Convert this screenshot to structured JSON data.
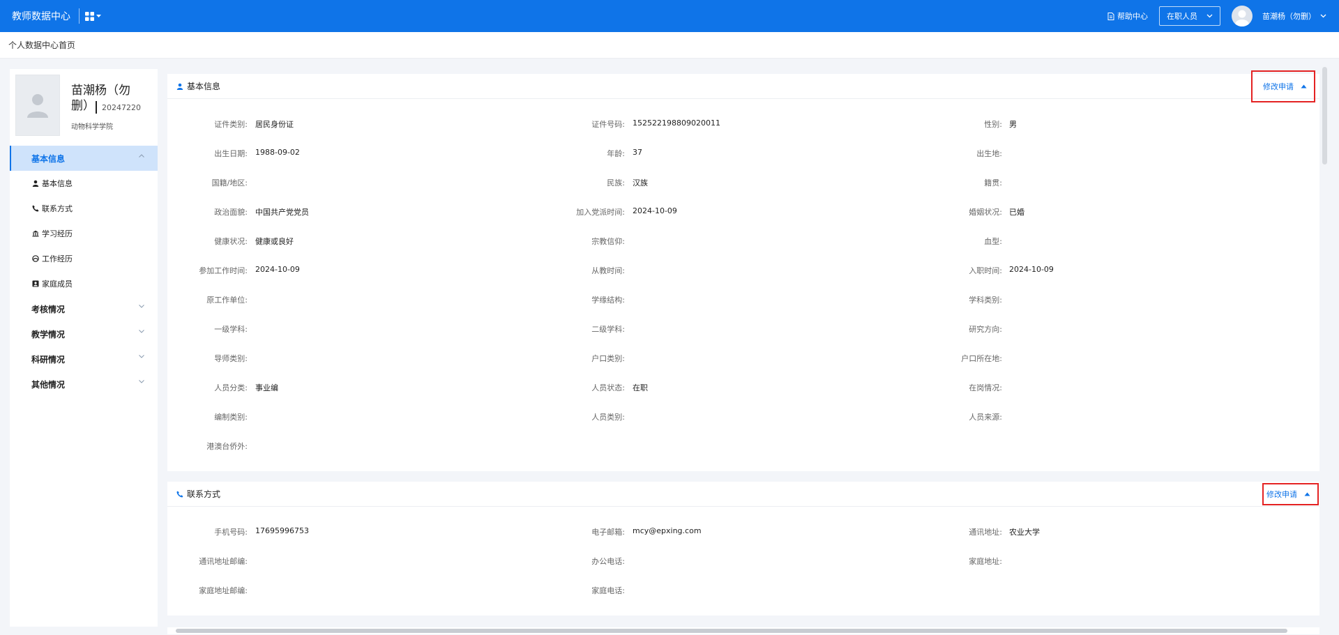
{
  "header": {
    "app_title": "教师数据中心",
    "help_label": "帮助中心",
    "role_select": "在职人员",
    "user_name": "苗潮杨（勿删）"
  },
  "breadcrumb": "个人数据中心首页",
  "profile": {
    "name": "苗潮杨（勿删）",
    "id": "20247220",
    "dept": "动物科学学院"
  },
  "sidebar": {
    "groups": [
      {
        "label": "基本信息",
        "active": true
      },
      {
        "label": "考核情况"
      },
      {
        "label": "教学情况"
      },
      {
        "label": "科研情况"
      },
      {
        "label": "其他情况"
      }
    ],
    "items": [
      {
        "label": "基本信息",
        "icon": "person-icon"
      },
      {
        "label": "联系方式",
        "icon": "phone-icon"
      },
      {
        "label": "学习经历",
        "icon": "school-icon"
      },
      {
        "label": "工作经历",
        "icon": "work-icon"
      },
      {
        "label": "家庭成员",
        "icon": "family-icon"
      }
    ]
  },
  "basic": {
    "title": "基本信息",
    "edit_label": "修改申请",
    "rows": [
      [
        {
          "label": "证件类别:",
          "value": "居民身份证"
        },
        {
          "label": "证件号码:",
          "value": "152522198809020011"
        },
        {
          "label": "性别:",
          "value": "男"
        }
      ],
      [
        {
          "label": "出生日期:",
          "value": "1988-09-02"
        },
        {
          "label": "年龄:",
          "value": "37"
        },
        {
          "label": "出生地:",
          "value": ""
        }
      ],
      [
        {
          "label": "国籍/地区:",
          "value": ""
        },
        {
          "label": "民族:",
          "value": "汉族"
        },
        {
          "label": "籍贯:",
          "value": ""
        }
      ],
      [
        {
          "label": "政治面貌:",
          "value": "中国共产党党员"
        },
        {
          "label": "加入党派时间:",
          "value": "2024-10-09"
        },
        {
          "label": "婚姻状况:",
          "value": "已婚"
        }
      ],
      [
        {
          "label": "健康状况:",
          "value": "健康或良好"
        },
        {
          "label": "宗教信仰:",
          "value": ""
        },
        {
          "label": "血型:",
          "value": ""
        }
      ],
      [
        {
          "label": "参加工作时间:",
          "value": "2024-10-09"
        },
        {
          "label": "从教时间:",
          "value": ""
        },
        {
          "label": "入职时间:",
          "value": "2024-10-09"
        }
      ],
      [
        {
          "label": "原工作单位:",
          "value": ""
        },
        {
          "label": "学缘结构:",
          "value": ""
        },
        {
          "label": "学科类别:",
          "value": ""
        }
      ],
      [
        {
          "label": "一级学科:",
          "value": ""
        },
        {
          "label": "二级学科:",
          "value": ""
        },
        {
          "label": "研究方向:",
          "value": ""
        }
      ],
      [
        {
          "label": "导师类别:",
          "value": ""
        },
        {
          "label": "户口类别:",
          "value": ""
        },
        {
          "label": "户口所在地:",
          "value": ""
        }
      ],
      [
        {
          "label": "人员分类:",
          "value": "事业编"
        },
        {
          "label": "人员状态:",
          "value": "在职"
        },
        {
          "label": "在岗情况:",
          "value": ""
        }
      ],
      [
        {
          "label": "编制类别:",
          "value": ""
        },
        {
          "label": "人员类别:",
          "value": ""
        },
        {
          "label": "人员来源:",
          "value": ""
        }
      ],
      [
        {
          "label": "港澳台侨外:",
          "value": ""
        }
      ]
    ]
  },
  "contact": {
    "title": "联系方式",
    "edit_label": "修改申请",
    "rows": [
      [
        {
          "label": "手机号码:",
          "value": "17695996753"
        },
        {
          "label": "电子邮箱:",
          "value": "mcy@epxing.com"
        },
        {
          "label": "通讯地址:",
          "value": "农业大学"
        }
      ],
      [
        {
          "label": "通讯地址邮编:",
          "value": ""
        },
        {
          "label": "办公电话:",
          "value": ""
        },
        {
          "label": "家庭地址:",
          "value": ""
        }
      ],
      [
        {
          "label": "家庭地址邮编:",
          "value": ""
        },
        {
          "label": "家庭电话:",
          "value": ""
        }
      ]
    ]
  },
  "colors": {
    "primary": "#0f74e8",
    "highlight_border": "#e42222",
    "active_bg": "#cfe3fb"
  }
}
